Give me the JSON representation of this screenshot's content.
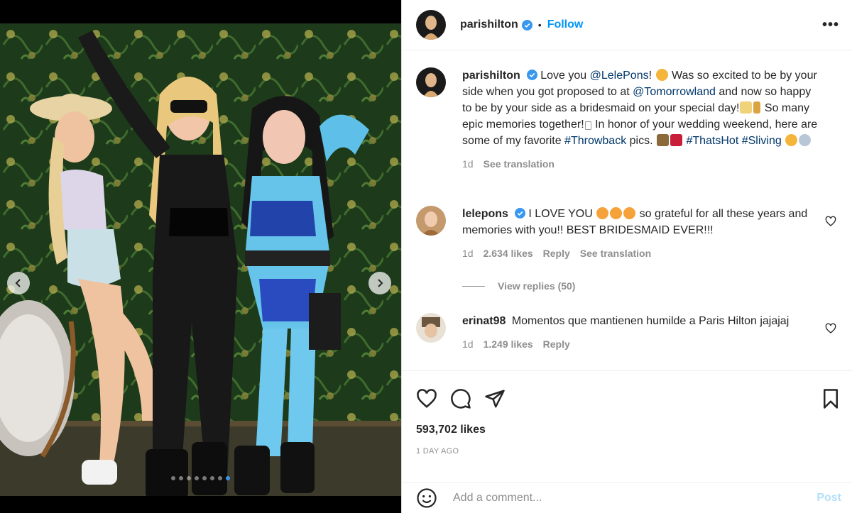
{
  "colors": {
    "accent": "#0095f6",
    "link": "#00376b",
    "muted": "#8e8e8e",
    "post_disabled": "#b2dffc",
    "verified": "#3897f0"
  },
  "header": {
    "username": "parishilton",
    "separator": "•",
    "follow_label": "Follow",
    "more_label": "•••"
  },
  "carousel": {
    "slide_count": 8,
    "active_index": 7,
    "prev_icon": "chevron-left-icon",
    "next_icon": "chevron-right-icon"
  },
  "caption": {
    "username": "parishilton",
    "t1": "Love you ",
    "mention1": "@LelePons",
    "t2": "!",
    "t3": " Was so excited to be by your side when you got proposed to at ",
    "mention2": "@Tomorrowland",
    "t4": " and now so happy to be by your side as a bridesmaid on your special day!",
    "t5": " So many epic memories together!",
    "t6": " In honor of your wedding weekend, here are some of my favorite ",
    "tag1": "#Throwback",
    "t7": " pics. ",
    "tag2": "#ThatsHot",
    "tag3": "#Sliving",
    "time": "1d",
    "see_translation": "See translation"
  },
  "comments": [
    {
      "username": "lelepons",
      "text_a": "I LOVE YOU ",
      "text_b": " so grateful for all these years and memories with you!! BEST BRIDESMAID EVER!!!",
      "time": "1d",
      "likes": "2.634 likes",
      "reply": "Reply",
      "see_translation": "See translation",
      "view_replies": "View replies (50)"
    },
    {
      "username": "erinat98",
      "text": "Momentos que mantienen humilde a Paris Hilton jajajaj",
      "time": "1d",
      "likes": "1.249 likes",
      "reply": "Reply"
    }
  ],
  "actions": {
    "like_icon": "heart-icon",
    "comment_icon": "comment-icon",
    "share_icon": "share-icon",
    "save_icon": "bookmark-icon"
  },
  "likes_text": "593,702 likes",
  "timestamp": "1 DAY AGO",
  "add_comment": {
    "placeholder": "Add a comment...",
    "post_label": "Post",
    "emoji_icon": "smiley-icon"
  }
}
